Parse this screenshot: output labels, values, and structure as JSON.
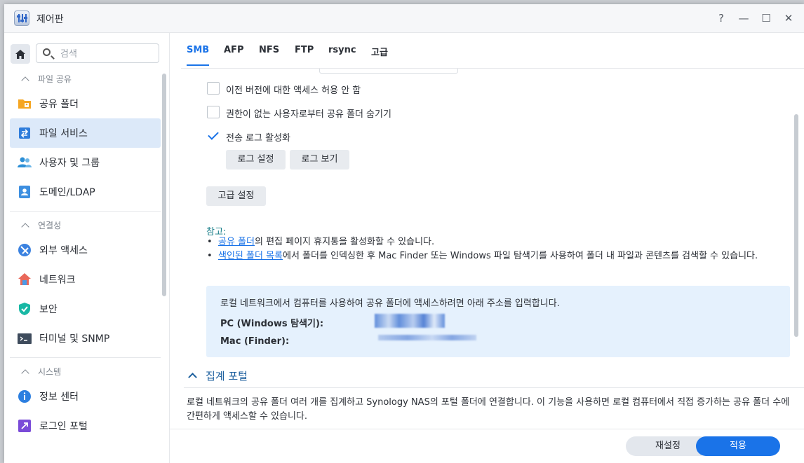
{
  "window": {
    "title": "제어판"
  },
  "titlebar_buttons": {
    "help": "?",
    "minimize": "—",
    "maximize": "☐",
    "close": "✕"
  },
  "search": {
    "placeholder": "검색"
  },
  "sidebar": {
    "sections": [
      {
        "label": "파일 공유",
        "items": [
          {
            "label": "공유 폴더",
            "icon": "shared-folder-icon"
          },
          {
            "label": "파일 서비스",
            "icon": "file-services-icon",
            "active": true
          },
          {
            "label": "사용자 및 그룹",
            "icon": "user-group-icon"
          },
          {
            "label": "도메인/LDAP",
            "icon": "domain-ldap-icon"
          }
        ]
      },
      {
        "label": "연결성",
        "items": [
          {
            "label": "외부 액세스",
            "icon": "external-access-icon"
          },
          {
            "label": "네트워크",
            "icon": "network-icon"
          },
          {
            "label": "보안",
            "icon": "security-shield-icon"
          },
          {
            "label": "터미널 및 SNMP",
            "icon": "terminal-icon"
          }
        ]
      },
      {
        "label": "시스템",
        "items": [
          {
            "label": "정보 센터",
            "icon": "info-center-icon"
          },
          {
            "label": "로그인 포털",
            "icon": "login-portal-icon"
          }
        ]
      }
    ]
  },
  "tabs": [
    "SMB",
    "AFP",
    "NFS",
    "FTP",
    "rsync",
    "고급"
  ],
  "active_tab": "SMB",
  "options": {
    "prev_versions": "이전 버전에 대한 액세스 허용 안 함",
    "hide_shares": "권한이 없는 사용자로부터 공유 폴더 숨기기",
    "transfer_log": "전송 로그 활성화"
  },
  "buttons": {
    "log_settings": "로그 설정",
    "view_log": "로그 보기",
    "advanced": "고급 설정"
  },
  "notes": {
    "title": "참고:",
    "b1_link": "공유 폴더",
    "b1_text": "의 편집 페이지 휴지통을 활성화할 수 있습니다.",
    "b2_link": "색인된 폴더 목록",
    "b2_text": "에서 폴더를 인덱싱한 후 Mac Finder 또는 Windows 파일 탐색기를 사용하여 폴더 내 파일과 콘텐츠를 검색할 수 있습니다."
  },
  "info": {
    "text": "로컬 네트워크에서 컴퓨터를 사용하여 공유 폴더에 액세스하려면 아래 주소를 입력합니다.",
    "pc_label": "PC (Windows 탐색기):",
    "mac_label": "Mac (Finder):"
  },
  "aggregation": {
    "title": "집계 포털",
    "desc": "로컬 네트워크의 공유 폴더 여러 개를 집계하고 Synology NAS의 포털 폴더에 연결합니다. 이 기능을 사용하면 로컬 컴퓨터에서 직접 증가하는 공유 폴더 수에 간편하게 액세스할 수 있습니다."
  },
  "footer": {
    "reset": "재설정",
    "apply": "적용"
  },
  "colors": {
    "accent": "#1a73e8",
    "active_bg": "#dce9f9",
    "info_bg": "#e5f1fd",
    "note_title": "#137b86"
  }
}
